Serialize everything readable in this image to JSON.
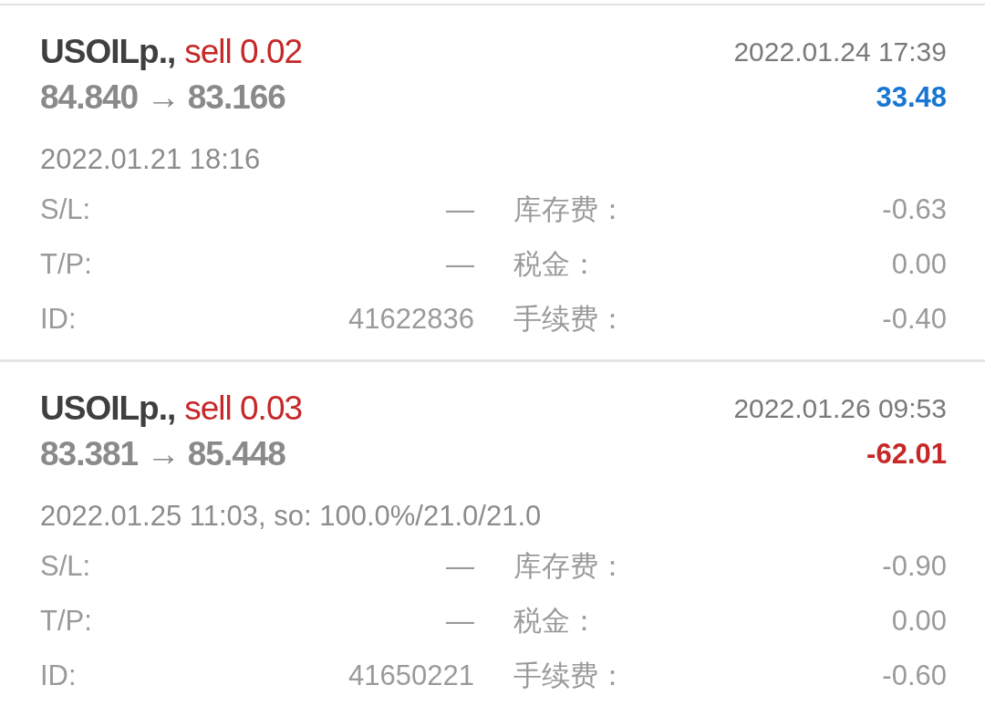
{
  "trades": [
    {
      "symbol": "USOILp.,",
      "side": "sell 0.02",
      "prices": "84.840 → 83.166",
      "close_time": "2022.01.24 17:39",
      "profit": "33.48",
      "loss": false,
      "open_info": "2022.01.21 18:16",
      "fields": [
        {
          "label": "S/L:",
          "value": "—",
          "label_2": "库存费：",
          "value_2": "-0.63"
        },
        {
          "label": "T/P:",
          "value": "—",
          "label_2": "税金：",
          "value_2": "0.00"
        },
        {
          "label": "ID:",
          "value": "41622836",
          "label_2": "手续费：",
          "value_2": "-0.40"
        }
      ]
    },
    {
      "symbol": "USOILp.,",
      "side": "sell 0.03",
      "prices": "83.381 → 85.448",
      "close_time": "2022.01.26 09:53",
      "profit": "-62.01",
      "loss": true,
      "open_info": "2022.01.25 11:03, so: 100.0%/21.0/21.0",
      "fields": [
        {
          "label": "S/L:",
          "value": "—",
          "label_2": "库存费：",
          "value_2": "-0.90"
        },
        {
          "label": "T/P:",
          "value": "—",
          "label_2": "税金：",
          "value_2": "0.00"
        },
        {
          "label": "ID:",
          "value": "41650221",
          "label_2": "手续费：",
          "value_2": "-0.60"
        }
      ]
    }
  ]
}
